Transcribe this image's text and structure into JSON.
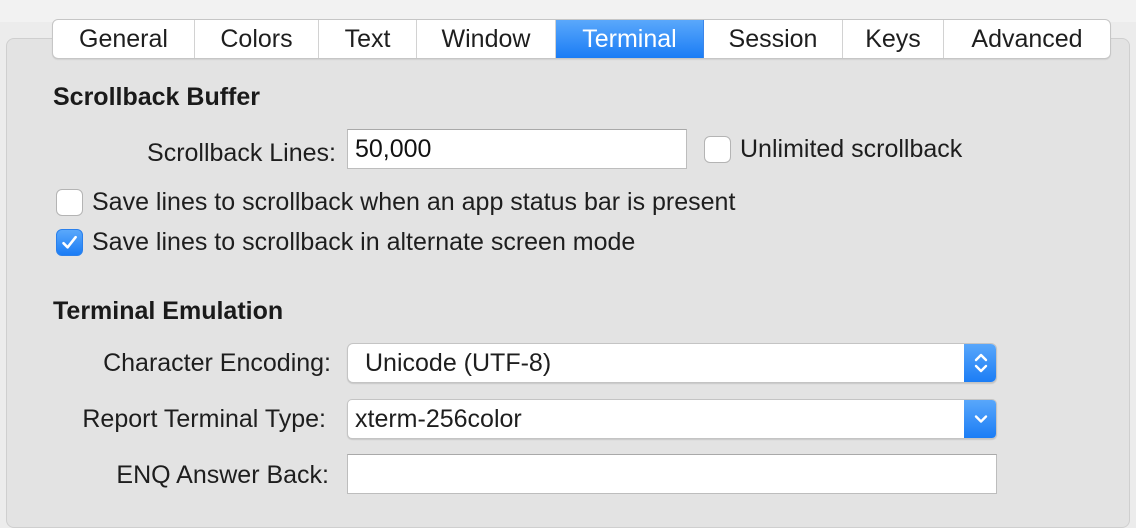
{
  "tabs": [
    {
      "label": "General",
      "active": false
    },
    {
      "label": "Colors",
      "active": false
    },
    {
      "label": "Text",
      "active": false
    },
    {
      "label": "Window",
      "active": false
    },
    {
      "label": "Terminal",
      "active": true
    },
    {
      "label": "Session",
      "active": false
    },
    {
      "label": "Keys",
      "active": false
    },
    {
      "label": "Advanced",
      "active": false
    }
  ],
  "scrollback": {
    "title": "Scrollback Buffer",
    "lines_label": "Scrollback Lines:",
    "lines_value": "50,000",
    "unlimited_label": "Unlimited scrollback",
    "unlimited_checked": false,
    "status_bar_label": "Save lines to scrollback when an app status bar is present",
    "status_bar_checked": false,
    "alternate_label": "Save lines to scrollback in alternate screen mode",
    "alternate_checked": true
  },
  "emulation": {
    "title": "Terminal Emulation",
    "encoding_label": "Character Encoding:",
    "encoding_value": "Unicode (UTF-8)",
    "terminal_type_label": "Report Terminal Type:",
    "terminal_type_value": "xterm-256color",
    "enq_label": "ENQ Answer Back:",
    "enq_value": ""
  },
  "colors": {
    "accent": "#1a7cf5",
    "background": "#ececec"
  }
}
